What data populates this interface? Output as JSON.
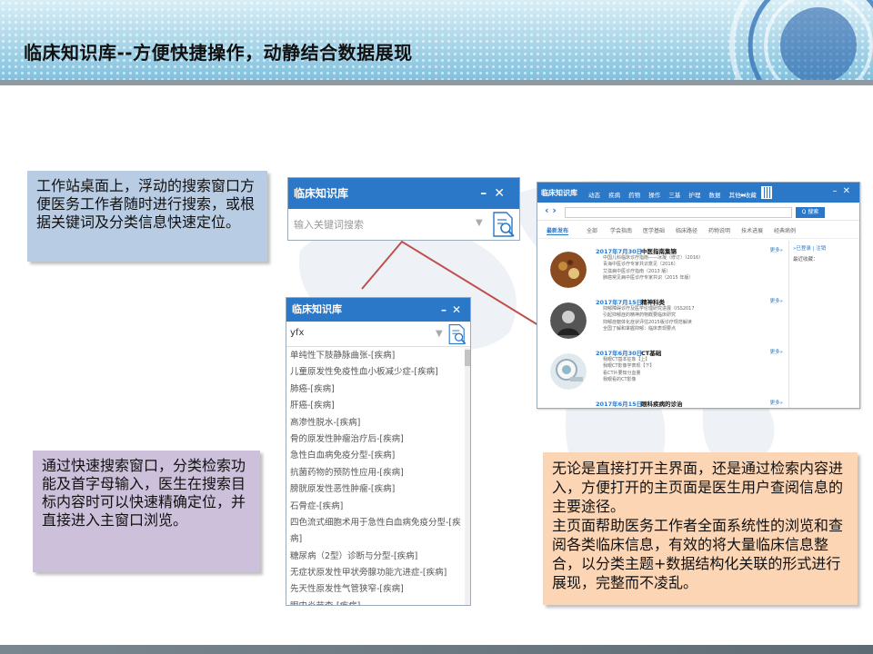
{
  "slide": {
    "title": "临床知识库--方便快捷操作，动静结合数据展现"
  },
  "callouts": {
    "desktop_search": "工作站桌面上，浮动的搜索窗口方便医务工作者随时进行搜索，或根据关键词及分类信息快速定位。",
    "quick_search": "通过快速搜索窗口，分类检索功能及首字母输入，医生在搜索目标内容时可以快速精确定位，并直接进入主窗口浏览。",
    "main_page_p1": "无论是直接打开主界面，还是通过检索内容进入，方便打开的主页面是医生用户查阅信息的主要途径。",
    "main_page_p2": "主页面帮助医务工作者全面系统性的浏览和查阅各类临床信息，有效的将大量临床信息整合，以分类主题+数据结构化关联的形式进行展现，完整而不凌乱。"
  },
  "search_widget": {
    "title": "临床知识库",
    "placeholder": "输入关键词搜索",
    "minimize": "–",
    "close": "✕"
  },
  "dropdown_widget": {
    "title": "临床知识库",
    "query": "yfx",
    "minimize": "–",
    "close": "✕",
    "results": [
      "单纯性下肢静脉曲张-[疾病]",
      "儿童原发性免疫性血小板减少症-[疾病]",
      "肺癌-[疾病]",
      "肝癌-[疾病]",
      "高渗性脱水-[疾病]",
      "骨的原发性肿瘤治疗后-[疾病]",
      "急性白血病免疫分型-[疾病]",
      "抗菌药物的预防性应用-[疾病]",
      "膀胱原发性恶性肿瘤-[疾病]",
      "石骨症-[疾病]",
      "四色流式细胞术用于急性白血病免疫分型-[疾病]",
      "糖尿病（2型）诊断与分型-[疾病]",
      "无症状原发性甲状旁腺功能亢进症-[疾病]",
      "先天性原发性气管狭窄-[疾病]",
      "眼内炎节查-[疾病]"
    ]
  },
  "portal": {
    "brand": "临床知识库",
    "nav_items": [
      "动态",
      "疾病",
      "药物",
      "操作",
      "三基",
      "护理",
      "数据",
      "其他 ▾"
    ],
    "favorite": "★收藏",
    "minimize": "–",
    "close": "✕",
    "search_button": "Q 搜索",
    "tabs": [
      "最新发布",
      "全部",
      "学会指南",
      "医学基础",
      "临床路径",
      "药物说明",
      "技术进展",
      "经典病例"
    ],
    "right_panel": {
      "login": "»已登录 | 注销",
      "recent": "最近收藏："
    },
    "entries": [
      {
        "date": "2017年7月30日",
        "title": "中医指南集锦",
        "more": "更多»",
        "lines": [
          "中国儿科临床诊疗指南——冰凝（修订）（2016）",
          "青海中医诊疗专家共识意见（2016）",
          "艾滋病中医诊疗指南（2013 版）",
          "肺癌常见病中医诊疗专家共识（2015 年版）"
        ]
      },
      {
        "date": "2017年7月15日",
        "title": "精神科类",
        "more": "更多»",
        "lines": [
          "抑郁障碍诊疗及医学伦理研究进展（ISS2017",
          "引起抑郁症的精神药物概要临床研究",
          "抑郁症躯体化症状评估2015版诊疗规范解读",
          "全国了解和掌握抑郁：临床表现要点"
        ]
      },
      {
        "date": "2017年6月30日",
        "title": "CT基础",
        "more": "更多»",
        "lines": [
          "我眼CT基本征象【上】",
          "我眼CT影像学表现【下】",
          "看CT片要知分血量",
          "我眼看的CT影像"
        ]
      },
      {
        "date": "2017年6月15日",
        "title": "眼科疾病的诊治",
        "more": "更多»",
        "lines": []
      }
    ]
  },
  "colors": {
    "window_blue": "#2b78c8",
    "callout_blue": "#b8cce4",
    "callout_purple": "#ccc0da",
    "callout_orange": "#fcd5b5",
    "leader_line": "#c0504d"
  }
}
